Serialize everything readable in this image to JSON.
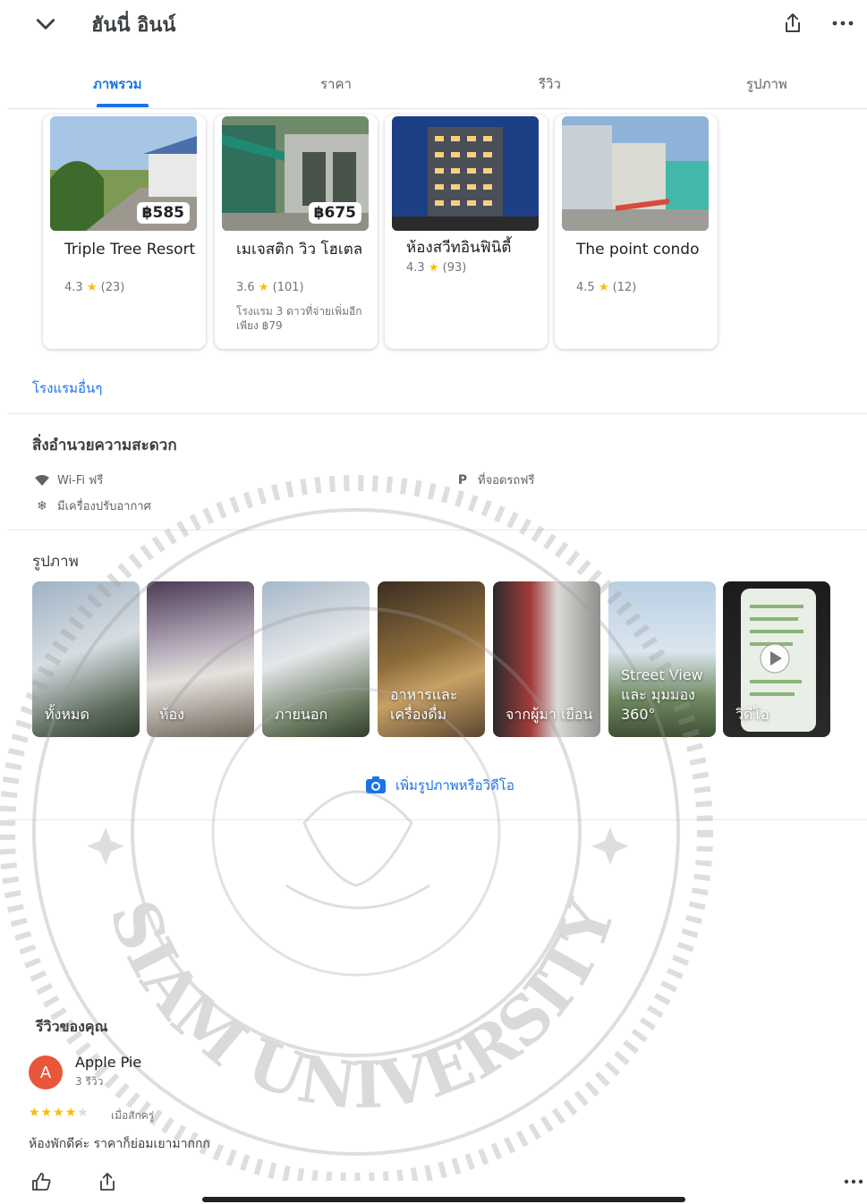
{
  "header": {
    "title": "ฮันนี่ อินน์",
    "back_icon": "chevron-down-icon",
    "share_icon": "share-icon",
    "more_icon": "more-horizontal-icon"
  },
  "tabs": [
    {
      "label": "ภาพรวม",
      "active": true
    },
    {
      "label": "ราคา",
      "active": false
    },
    {
      "label": "รีวิว",
      "active": false
    },
    {
      "label": "รูปภาพ",
      "active": false
    }
  ],
  "hotels": [
    {
      "name": "Triple Tree Resort",
      "price": "฿585",
      "rating": "4.3",
      "reviews": "(23)",
      "note": ""
    },
    {
      "name": "เมเจสติก วิว โฮเตล",
      "price": "฿675",
      "rating": "3.6",
      "reviews": "(101)",
      "note": "โรงแรม 3 ดาวที่จ่ายเพิ่มอีกเพียง ฿79"
    },
    {
      "name": "ห้องสวีทอินฟินิตี้",
      "price": "",
      "rating": "4.3",
      "reviews": "(93)",
      "note": ""
    },
    {
      "name": "The point condo",
      "price": "",
      "rating": "4.5",
      "reviews": "(12)",
      "note": ""
    }
  ],
  "other_hotels_link": "โรงแรมอื่นๆ",
  "amenities": {
    "title": "สิ่งอำนวยความสะดวก",
    "items": [
      {
        "icon": "wifi-icon",
        "label": "Wi-Fi ฟรี"
      },
      {
        "icon": "parking-icon",
        "label": "ที่จอดรถฟรี"
      },
      {
        "icon": "snowflake-icon",
        "label": "มีเครื่องปรับอากาศ"
      }
    ]
  },
  "photos": {
    "title": "รูปภาพ",
    "categories": [
      {
        "label": "ทั้งหมด"
      },
      {
        "label": "ห้อง"
      },
      {
        "label": "ภายนอก"
      },
      {
        "label": "อาหารและ เครื่องดื่ม"
      },
      {
        "label": "จากผู้มา เยือน"
      },
      {
        "label": "Street View และ มุมมอง 360°"
      },
      {
        "label": "วิดีโอ"
      }
    ],
    "add_label": "เพิ่มรูปภาพหรือวิดีโอ"
  },
  "watermark_text": "SIAM UNIVERSITY",
  "review": {
    "title": "รีวิวของคุณ",
    "avatar_letter": "A",
    "avatar_color": "#e8563a",
    "reviewer": "Apple Pie",
    "review_count": "3 รีวิว",
    "stars": 4,
    "time": "เมื่อสักครู่",
    "text": "ห้องพักดีค่ะ ราคาก็ย่อมเยามากกก"
  },
  "colors": {
    "accent": "#1a73e8",
    "star": "#fbbc04"
  }
}
